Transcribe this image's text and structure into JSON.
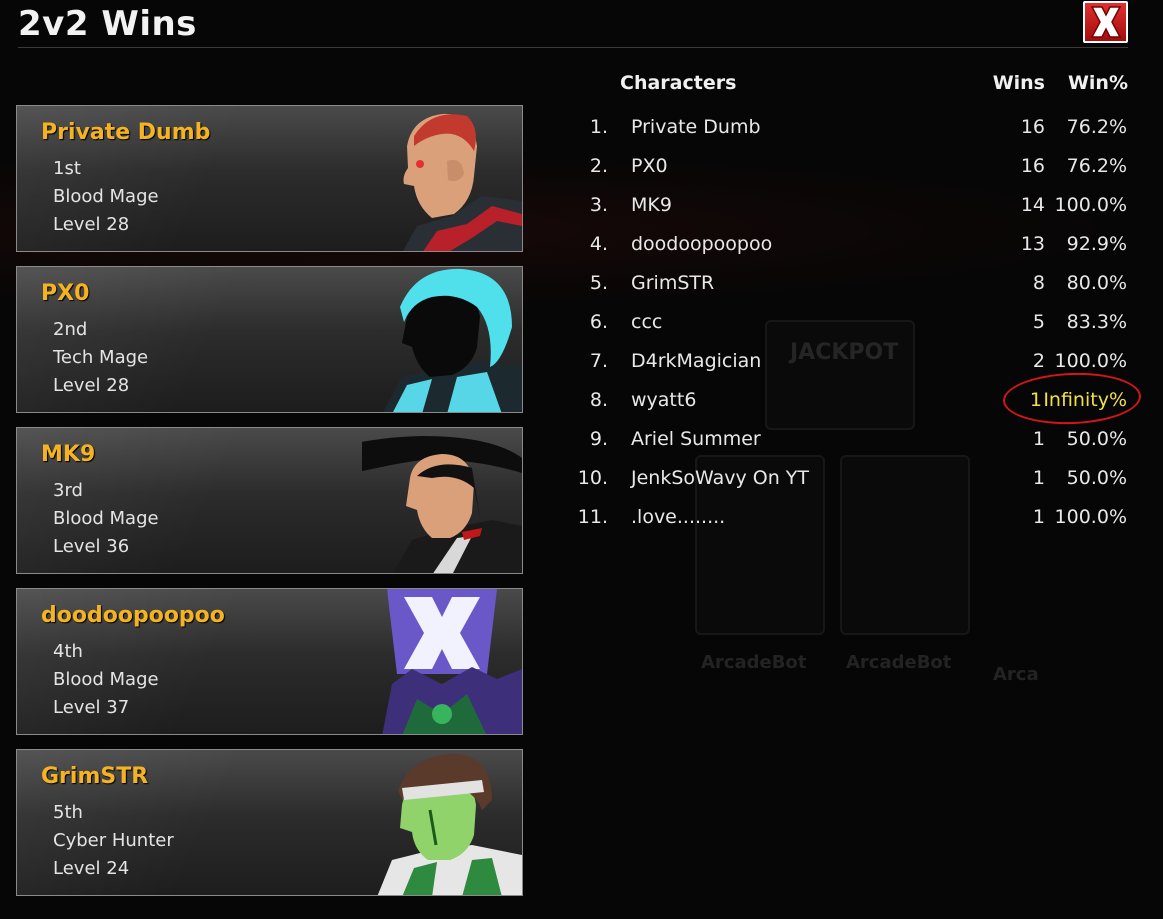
{
  "window": {
    "title": "2v2 Wins",
    "close_label": "X"
  },
  "cards": [
    {
      "name": "Private Dumb",
      "place": "1st",
      "class": "Blood Mage",
      "level": "Level 28"
    },
    {
      "name": "PX0",
      "place": "2nd",
      "class": "Tech Mage",
      "level": "Level 28"
    },
    {
      "name": "MK9",
      "place": "3rd",
      "class": "Blood Mage",
      "level": "Level 36"
    },
    {
      "name": "doodoopoopoo",
      "place": "4th",
      "class": "Blood Mage",
      "level": "Level 37"
    },
    {
      "name": "GrimSTR",
      "place": "5th",
      "class": "Cyber Hunter",
      "level": "Level 24"
    }
  ],
  "leaderboard": {
    "headers": {
      "characters": "Characters",
      "wins": "Wins",
      "winpct": "Win%"
    },
    "rows": [
      {
        "rank": "1.",
        "name": "Private Dumb",
        "wins": "16",
        "pct": "76.2%"
      },
      {
        "rank": "2.",
        "name": "PX0",
        "wins": "16",
        "pct": "76.2%"
      },
      {
        "rank": "3.",
        "name": "MK9",
        "wins": "14",
        "pct": "100.0%"
      },
      {
        "rank": "4.",
        "name": "doodoopoopoo",
        "wins": "13",
        "pct": "92.9%"
      },
      {
        "rank": "5.",
        "name": "GrimSTR",
        "wins": "8",
        "pct": "80.0%"
      },
      {
        "rank": "6.",
        "name": "ccc",
        "wins": "5",
        "pct": "83.3%"
      },
      {
        "rank": "7.",
        "name": "D4rkMagician",
        "wins": "2",
        "pct": "100.0%"
      },
      {
        "rank": "8.",
        "name": "wyatt6",
        "wins": "1",
        "pct": "Infinity%"
      },
      {
        "rank": "9.",
        "name": "Ariel Summer",
        "wins": "1",
        "pct": "50.0%"
      },
      {
        "rank": "10.",
        "name": "JenkSoWavy On YT",
        "wins": "1",
        "pct": "50.0%"
      },
      {
        "rank": "11.",
        "name": ".love........",
        "wins": "1",
        "pct": "100.0%"
      }
    ]
  },
  "background": {
    "signs": [
      "JACKPOT",
      "ArcadeBot",
      "ArcadeBot",
      "Arca"
    ]
  },
  "colors": {
    "name_gold": "#f5b321",
    "highlight_yellow": "#f1e04a",
    "annotation_red": "#d41616",
    "close_red": "#c41a1a"
  }
}
